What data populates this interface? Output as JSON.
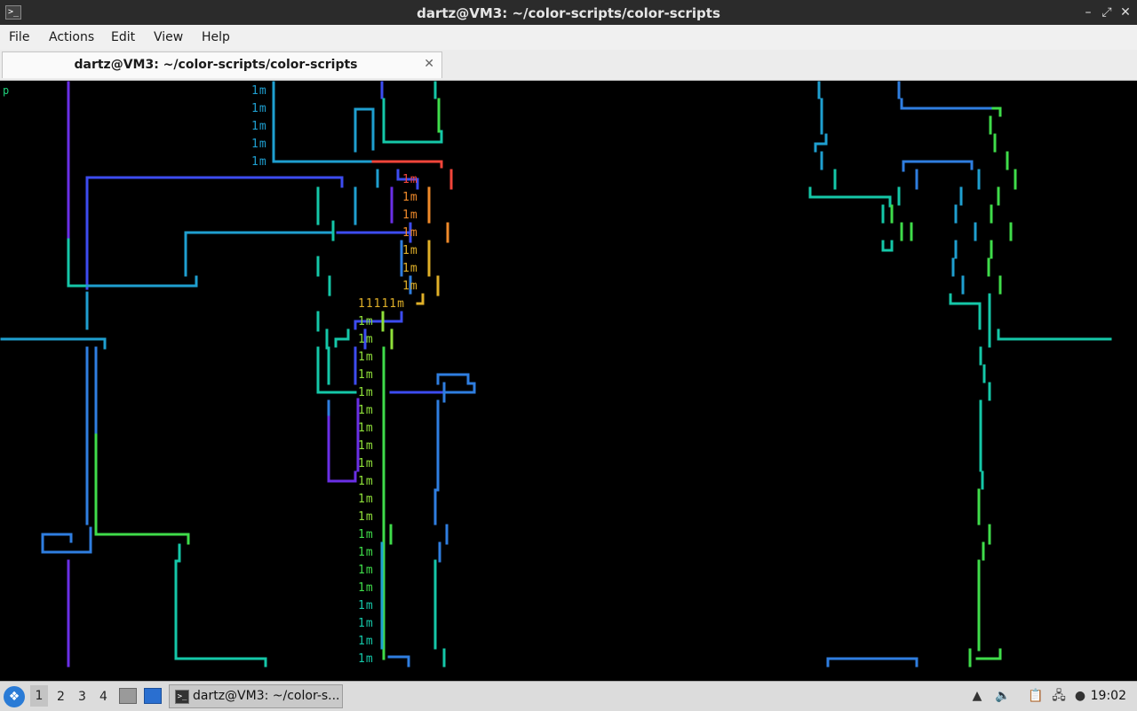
{
  "window": {
    "title": "dartz@VM3: ~/color-scripts/color-scripts",
    "icon": "terminal-icon",
    "controls": {
      "minimize": "–",
      "maximize": "⤢",
      "close": "✕"
    }
  },
  "menubar": {
    "items": [
      "File",
      "Actions",
      "Edit",
      "View",
      "Help"
    ]
  },
  "tabs": [
    {
      "label": "dartz@VM3: ~/color-scripts/color-scripts",
      "close": "✕"
    }
  ],
  "terminal": {
    "prompt_fragment": "p",
    "text_fragments": {
      "m_label": "1m",
      "row_label": "11111m"
    },
    "colors": {
      "blue": "#2f7ee0",
      "cyan_blue": "#1f9fd0",
      "teal": "#15c7a8",
      "green": "#3fdc4a",
      "lime": "#8fe03a",
      "violet": "#6a2fe6",
      "indigo": "#3d4cf0",
      "orange": "#f08a2a",
      "red": "#f2453a",
      "gold": "#e0b028"
    }
  },
  "taskbar": {
    "start_icon": "start-menu-icon",
    "workspaces": [
      "1",
      "2",
      "3",
      "4"
    ],
    "active_workspace": "1",
    "task": {
      "label": "dartz@VM3: ~/color-s...",
      "icon": "terminal-icon"
    },
    "tray_icons": [
      "volume-icon",
      "clipboard-icon",
      "network-icon",
      "update-icon"
    ],
    "clock": "19:02"
  }
}
